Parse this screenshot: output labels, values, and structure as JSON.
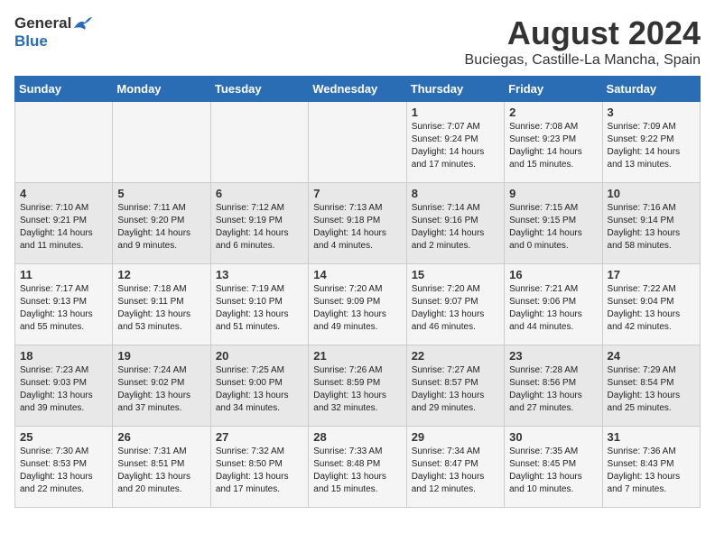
{
  "header": {
    "logo_general": "General",
    "logo_blue": "Blue",
    "title": "August 2024",
    "subtitle": "Buciegas, Castille-La Mancha, Spain"
  },
  "weekdays": [
    "Sunday",
    "Monday",
    "Tuesday",
    "Wednesday",
    "Thursday",
    "Friday",
    "Saturday"
  ],
  "weeks": [
    [
      {
        "day": "",
        "info": ""
      },
      {
        "day": "",
        "info": ""
      },
      {
        "day": "",
        "info": ""
      },
      {
        "day": "",
        "info": ""
      },
      {
        "day": "1",
        "info": "Sunrise: 7:07 AM\nSunset: 9:24 PM\nDaylight: 14 hours\nand 17 minutes."
      },
      {
        "day": "2",
        "info": "Sunrise: 7:08 AM\nSunset: 9:23 PM\nDaylight: 14 hours\nand 15 minutes."
      },
      {
        "day": "3",
        "info": "Sunrise: 7:09 AM\nSunset: 9:22 PM\nDaylight: 14 hours\nand 13 minutes."
      }
    ],
    [
      {
        "day": "4",
        "info": "Sunrise: 7:10 AM\nSunset: 9:21 PM\nDaylight: 14 hours\nand 11 minutes."
      },
      {
        "day": "5",
        "info": "Sunrise: 7:11 AM\nSunset: 9:20 PM\nDaylight: 14 hours\nand 9 minutes."
      },
      {
        "day": "6",
        "info": "Sunrise: 7:12 AM\nSunset: 9:19 PM\nDaylight: 14 hours\nand 6 minutes."
      },
      {
        "day": "7",
        "info": "Sunrise: 7:13 AM\nSunset: 9:18 PM\nDaylight: 14 hours\nand 4 minutes."
      },
      {
        "day": "8",
        "info": "Sunrise: 7:14 AM\nSunset: 9:16 PM\nDaylight: 14 hours\nand 2 minutes."
      },
      {
        "day": "9",
        "info": "Sunrise: 7:15 AM\nSunset: 9:15 PM\nDaylight: 14 hours\nand 0 minutes."
      },
      {
        "day": "10",
        "info": "Sunrise: 7:16 AM\nSunset: 9:14 PM\nDaylight: 13 hours\nand 58 minutes."
      }
    ],
    [
      {
        "day": "11",
        "info": "Sunrise: 7:17 AM\nSunset: 9:13 PM\nDaylight: 13 hours\nand 55 minutes."
      },
      {
        "day": "12",
        "info": "Sunrise: 7:18 AM\nSunset: 9:11 PM\nDaylight: 13 hours\nand 53 minutes."
      },
      {
        "day": "13",
        "info": "Sunrise: 7:19 AM\nSunset: 9:10 PM\nDaylight: 13 hours\nand 51 minutes."
      },
      {
        "day": "14",
        "info": "Sunrise: 7:20 AM\nSunset: 9:09 PM\nDaylight: 13 hours\nand 49 minutes."
      },
      {
        "day": "15",
        "info": "Sunrise: 7:20 AM\nSunset: 9:07 PM\nDaylight: 13 hours\nand 46 minutes."
      },
      {
        "day": "16",
        "info": "Sunrise: 7:21 AM\nSunset: 9:06 PM\nDaylight: 13 hours\nand 44 minutes."
      },
      {
        "day": "17",
        "info": "Sunrise: 7:22 AM\nSunset: 9:04 PM\nDaylight: 13 hours\nand 42 minutes."
      }
    ],
    [
      {
        "day": "18",
        "info": "Sunrise: 7:23 AM\nSunset: 9:03 PM\nDaylight: 13 hours\nand 39 minutes."
      },
      {
        "day": "19",
        "info": "Sunrise: 7:24 AM\nSunset: 9:02 PM\nDaylight: 13 hours\nand 37 minutes."
      },
      {
        "day": "20",
        "info": "Sunrise: 7:25 AM\nSunset: 9:00 PM\nDaylight: 13 hours\nand 34 minutes."
      },
      {
        "day": "21",
        "info": "Sunrise: 7:26 AM\nSunset: 8:59 PM\nDaylight: 13 hours\nand 32 minutes."
      },
      {
        "day": "22",
        "info": "Sunrise: 7:27 AM\nSunset: 8:57 PM\nDaylight: 13 hours\nand 29 minutes."
      },
      {
        "day": "23",
        "info": "Sunrise: 7:28 AM\nSunset: 8:56 PM\nDaylight: 13 hours\nand 27 minutes."
      },
      {
        "day": "24",
        "info": "Sunrise: 7:29 AM\nSunset: 8:54 PM\nDaylight: 13 hours\nand 25 minutes."
      }
    ],
    [
      {
        "day": "25",
        "info": "Sunrise: 7:30 AM\nSunset: 8:53 PM\nDaylight: 13 hours\nand 22 minutes."
      },
      {
        "day": "26",
        "info": "Sunrise: 7:31 AM\nSunset: 8:51 PM\nDaylight: 13 hours\nand 20 minutes."
      },
      {
        "day": "27",
        "info": "Sunrise: 7:32 AM\nSunset: 8:50 PM\nDaylight: 13 hours\nand 17 minutes."
      },
      {
        "day": "28",
        "info": "Sunrise: 7:33 AM\nSunset: 8:48 PM\nDaylight: 13 hours\nand 15 minutes."
      },
      {
        "day": "29",
        "info": "Sunrise: 7:34 AM\nSunset: 8:47 PM\nDaylight: 13 hours\nand 12 minutes."
      },
      {
        "day": "30",
        "info": "Sunrise: 7:35 AM\nSunset: 8:45 PM\nDaylight: 13 hours\nand 10 minutes."
      },
      {
        "day": "31",
        "info": "Sunrise: 7:36 AM\nSunset: 8:43 PM\nDaylight: 13 hours\nand 7 minutes."
      }
    ]
  ],
  "colors": {
    "header_bg": "#2a6db5",
    "header_text": "#ffffff",
    "odd_row": "#f5f5f5",
    "even_row": "#e8e8e8"
  }
}
